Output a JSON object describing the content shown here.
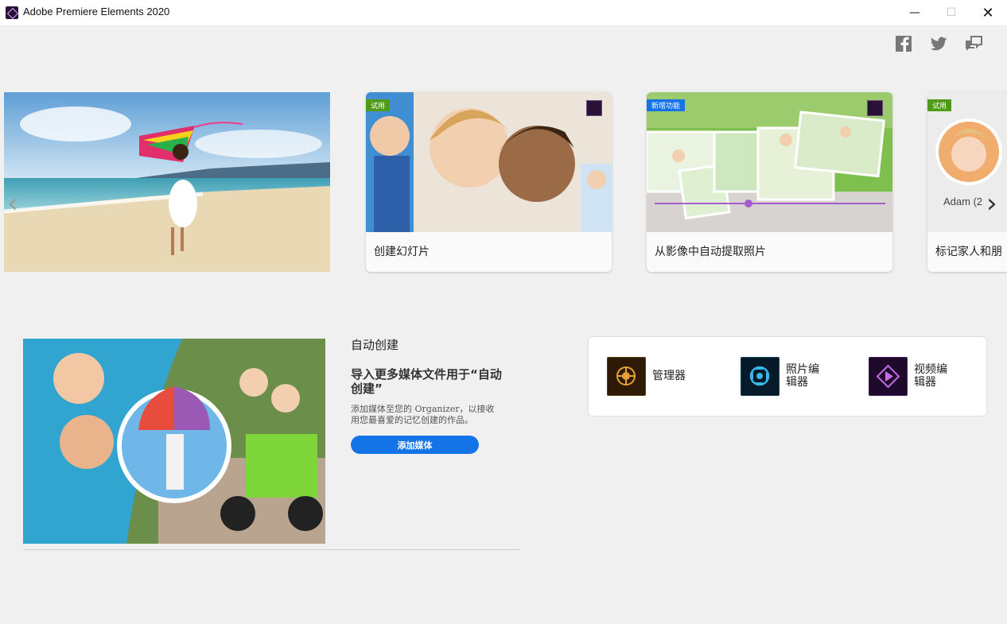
{
  "window": {
    "title": "Adobe Premiere Elements 2020"
  },
  "window_controls": {
    "minimize": "—",
    "maximize": "☐",
    "close": "✕"
  },
  "social": [
    "facebook-icon",
    "twitter-icon",
    "feedback-icon"
  ],
  "carousel": {
    "prev": "‹",
    "next": "›",
    "cards": [
      {
        "badge": "试用",
        "label": "创建幻灯片"
      },
      {
        "badge": "新增功能",
        "label": "从影像中自动提取照片"
      },
      {
        "badge": "试用",
        "label": "标记家人和朋",
        "caption": "Adam (2"
      }
    ]
  },
  "auto_create": {
    "heading": "自动创建",
    "title": "导入更多媒体文件用于“自动创建”",
    "description": "添加媒体至您的 Organizer，以接收用您最喜爱的记忆创建的作品。",
    "button": "添加媒体"
  },
  "apps": [
    {
      "name": "管理器",
      "icon": "organizer-icon"
    },
    {
      "name": "照片编辑器",
      "icon": "photo-editor-icon"
    },
    {
      "name": "视频编辑器",
      "icon": "video-editor-icon"
    }
  ],
  "colors": {
    "accent": "#1473e6",
    "trial_badge": "#4f9b18",
    "new_badge": "#1473e6"
  }
}
